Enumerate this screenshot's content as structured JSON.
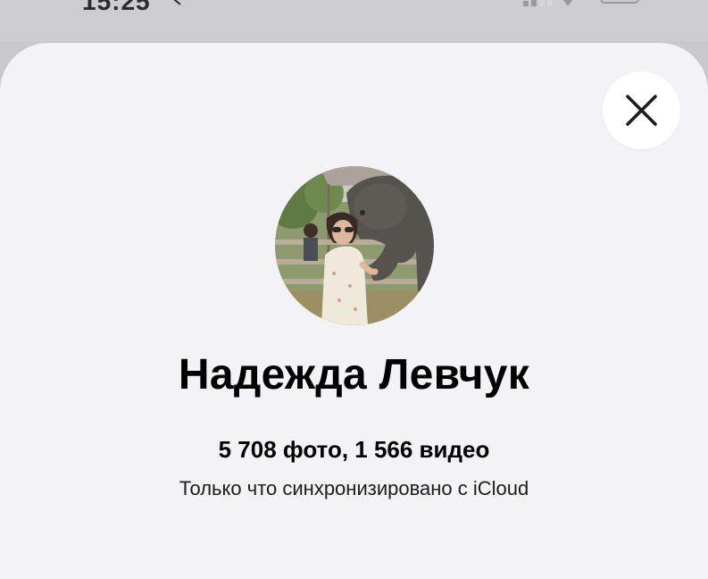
{
  "status_bar": {
    "time": "15:25"
  },
  "sheet": {
    "close_label": "close"
  },
  "profile": {
    "name": "Надежда Левчук",
    "media_count": "5 708 фото, 1 566 видео",
    "sync_status": "Только что синхронизировано с iCloud"
  },
  "colors": {
    "sheet_background": "#f2f2f7",
    "backdrop": "#c9c9cd",
    "close_button_bg": "#ffffff",
    "text_primary": "#000000"
  },
  "icons": {
    "close": "close-icon",
    "avatar": "avatar"
  }
}
